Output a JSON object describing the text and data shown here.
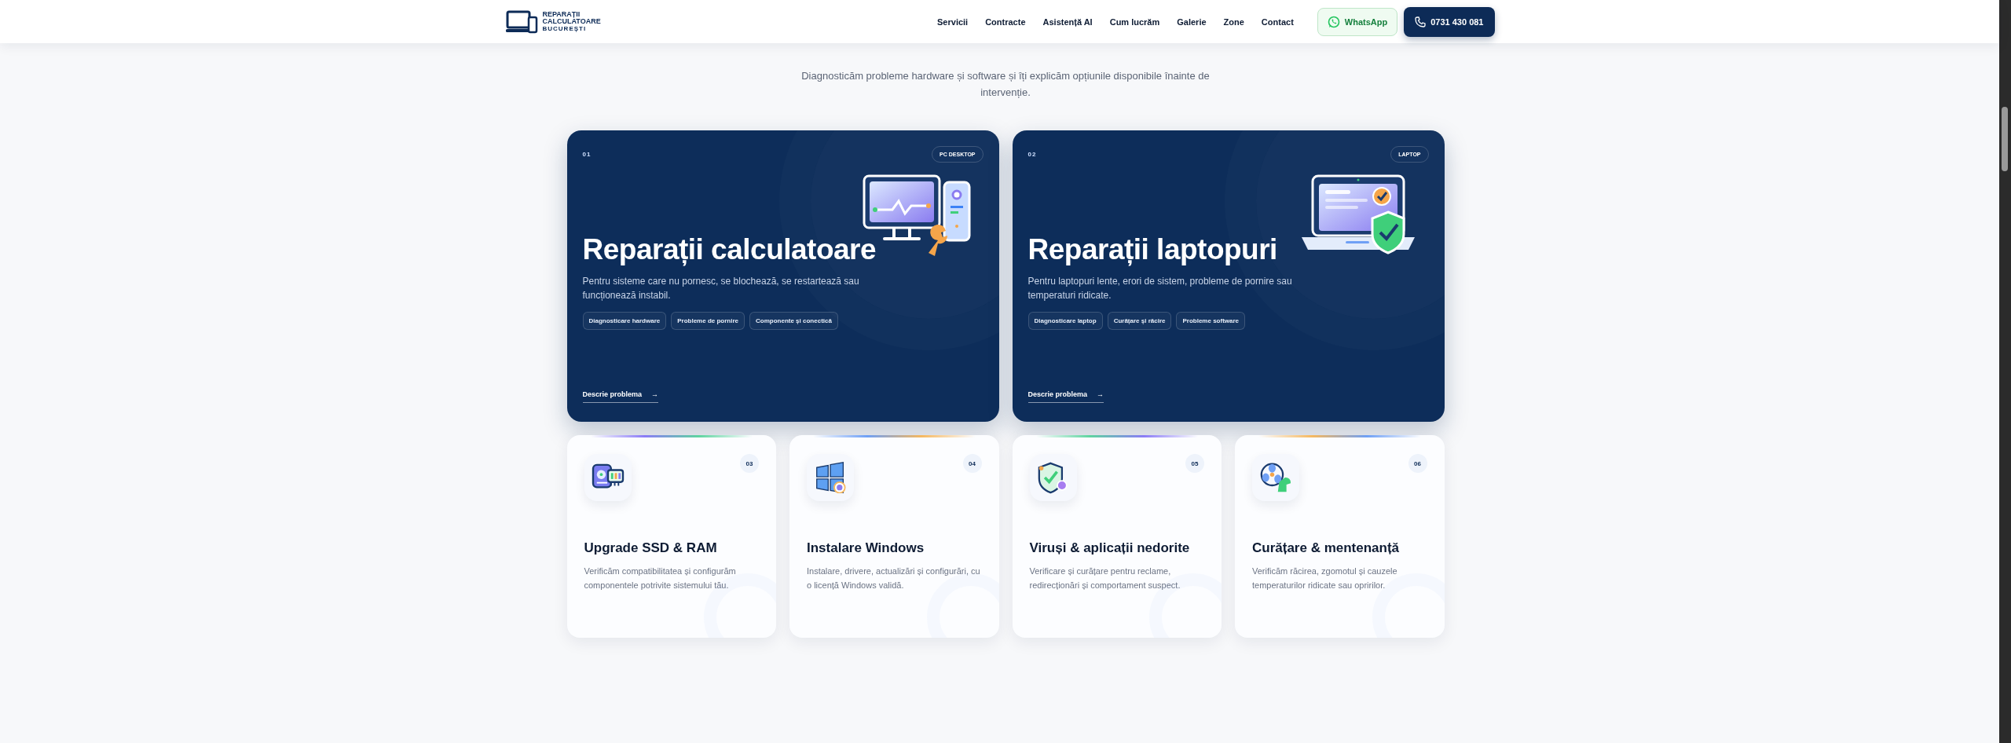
{
  "header": {
    "logo": {
      "line1": "REPARAȚII",
      "line2": "CALCULATOARE",
      "line3": "BUCUREȘTI"
    },
    "nav": [
      {
        "label": "Servicii"
      },
      {
        "label": "Contracte"
      },
      {
        "label": "Asistență AI"
      },
      {
        "label": "Cum lucrăm"
      },
      {
        "label": "Galerie"
      },
      {
        "label": "Zone"
      },
      {
        "label": "Contact"
      }
    ],
    "whatsapp": "WhatsApp",
    "phone": "0731 430 081"
  },
  "section": {
    "subtitle": "Diagnosticăm probleme hardware și software și îți explicăm opțiunile disponibile înainte de intervenție."
  },
  "featured": [
    {
      "number": "01",
      "tag": "PC DESKTOP",
      "title": "Reparații calculatoare",
      "description": "Pentru sisteme care nu pornesc, se blochează, se restartează sau funcționează instabil.",
      "chips": [
        "Diagnosticare hardware",
        "Probleme de pornire",
        "Componente și conectică"
      ],
      "link": "Descrie problema",
      "arrow": "→"
    },
    {
      "number": "02",
      "tag": "LAPTOP",
      "title": "Reparații laptopuri",
      "description": "Pentru laptopuri lente, erori de sistem, probleme de pornire sau temperaturi ridicate.",
      "chips": [
        "Diagnosticare laptop",
        "Curățare și răcire",
        "Probleme software"
      ],
      "link": "Descrie problema",
      "arrow": "→"
    }
  ],
  "services": [
    {
      "number": "03",
      "title": "Upgrade SSD & RAM",
      "description": "Verificăm compatibilitatea și configurăm componentele potrivite sistemului tău."
    },
    {
      "number": "04",
      "title": "Instalare Windows",
      "description": "Instalare, drivere, actualizări și configurări, cu o licență Windows validă."
    },
    {
      "number": "05",
      "title": "Viruși & aplicații nedorite",
      "description": "Verificare și curățare pentru reclame, redirecționări și comportament suspect."
    },
    {
      "number": "06",
      "title": "Curățare & mentenanță",
      "description": "Verificăm răcirea, zgomotul și cauzele temperaturilor ridicate sau opririlor."
    }
  ]
}
